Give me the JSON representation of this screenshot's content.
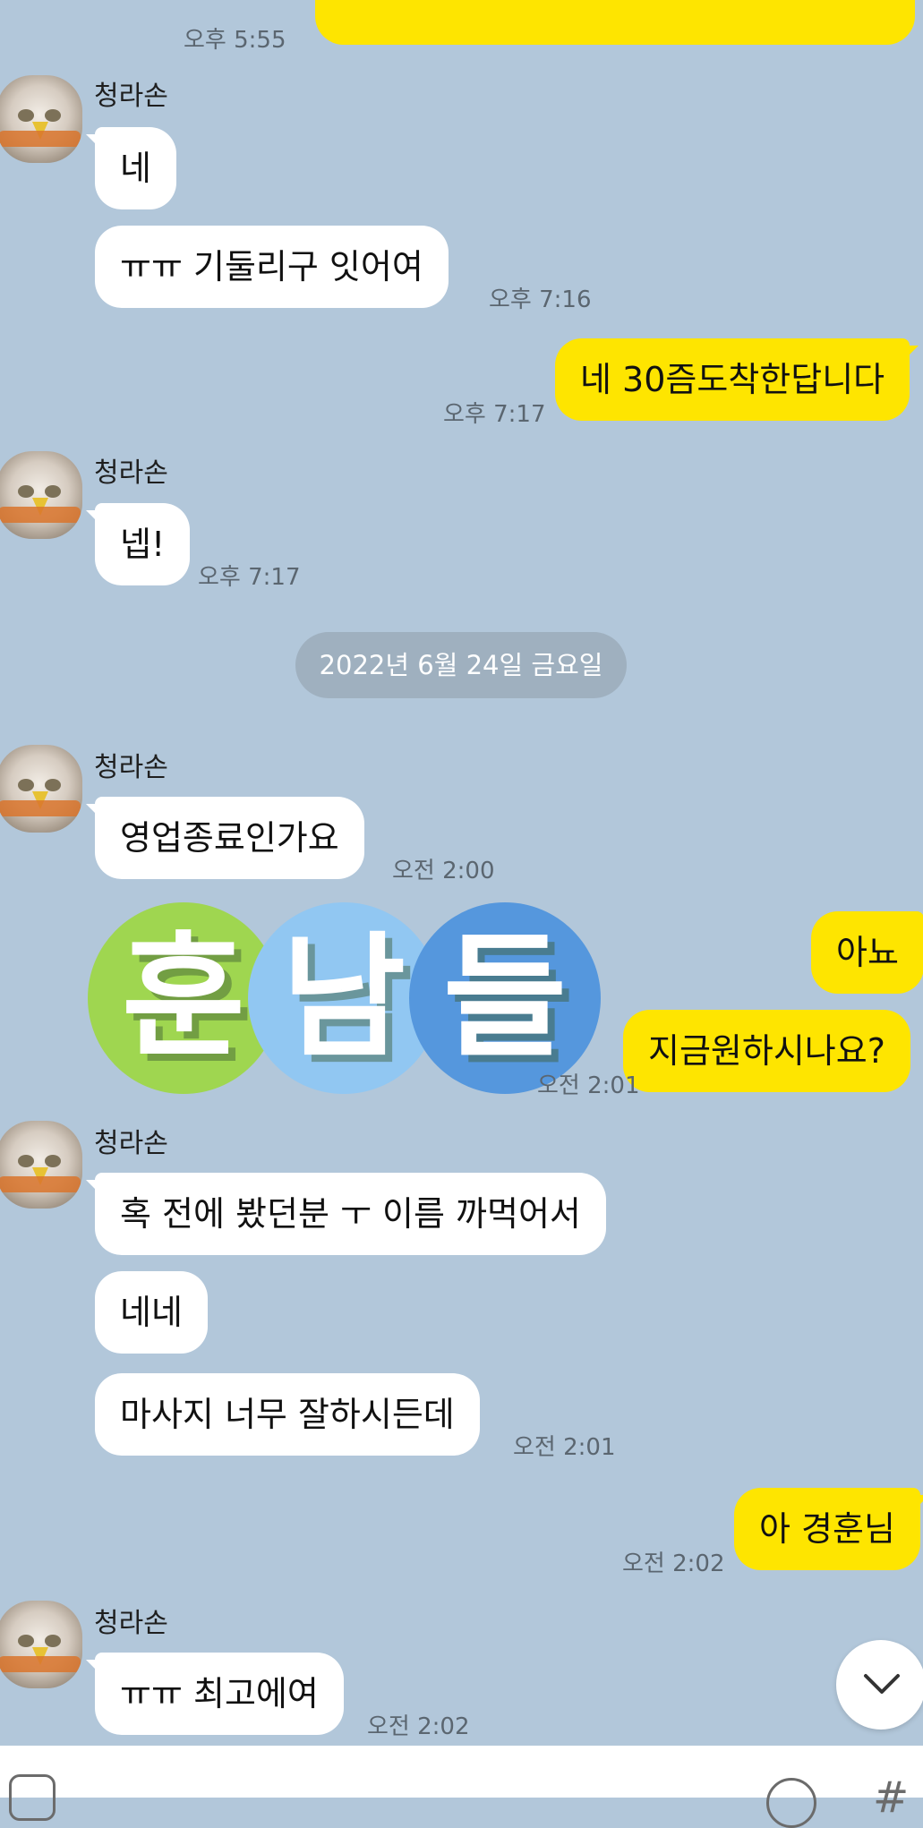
{
  "chat": {
    "top_partial_time": "오후 5:55",
    "date_divider": "2022년 6월 24일 금요일",
    "messages": [
      {
        "sender": "청라손",
        "text": "네"
      },
      {
        "text": "ㅠㅠ 기둘리구 잇어여",
        "time": "오후 7:16"
      },
      {
        "text": "네 30즘도착한답니다",
        "time": "오후 7:17",
        "mine": true
      },
      {
        "sender": "청라손",
        "text": "넵!",
        "time": "오후 7:17"
      },
      {
        "sender": "청라손",
        "text": "영업종료인가요",
        "time": "오전 2:00"
      },
      {
        "text": "아뇨",
        "mine": true
      },
      {
        "text": "지금원하시나요?",
        "mine": true,
        "time": "오전 2:01"
      },
      {
        "sender": "청라손",
        "text": "혹 전에 봤던분 ㅜ 이름 까먹어서"
      },
      {
        "text": "네네"
      },
      {
        "text": "마사지 너무 잘하시든데",
        "time": "오전 2:01"
      },
      {
        "text": "아 경훈님",
        "time": "오전 2:02",
        "mine": true
      },
      {
        "sender": "청라손",
        "text": "ㅠㅠ 최고에여",
        "time": "오전 2:02"
      }
    ],
    "emoticon": {
      "chars": [
        "훈",
        "남",
        "들"
      ],
      "colors": [
        "#9fd650",
        "#91c7f2",
        "#5597dd"
      ]
    }
  },
  "colors": {
    "background": "#b2c7da",
    "my_bubble": "#fee500",
    "their_bubble": "#ffffff"
  },
  "icons": {
    "scroll_down": "chevron-down-icon",
    "attach": "plus-icon",
    "emoji": "emoji-icon",
    "hashtag": "hash-icon"
  }
}
